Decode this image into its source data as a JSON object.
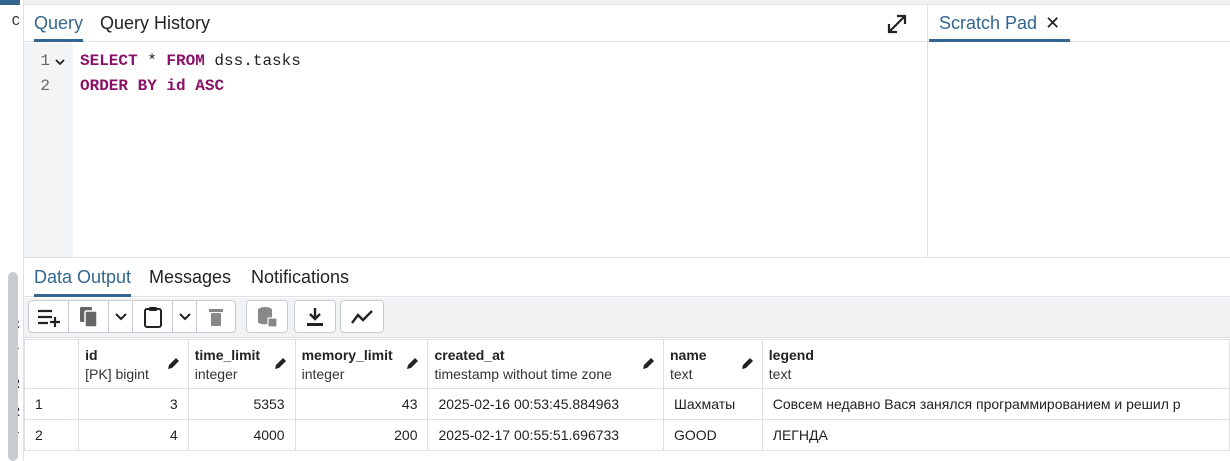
{
  "left_strip": {
    "chars": [
      "C",
      "C",
      "r",
      "R",
      "R",
      "r"
    ]
  },
  "query_tool": {
    "tabs": [
      "Query",
      "Query History"
    ],
    "line_numbers": [
      "1",
      "2"
    ],
    "code": {
      "line1": {
        "kw1": "SELECT",
        "star": " * ",
        "kw2": "FROM",
        "rest": " dss.tasks"
      },
      "line2": {
        "kw1": "ORDER",
        "sp": " ",
        "kw2": "BY",
        "mid": " id ",
        "kw3": "ASC"
      }
    }
  },
  "scratch_pad": {
    "tab_label": "Scratch Pad"
  },
  "output": {
    "tabs": [
      "Data Output",
      "Messages",
      "Notifications"
    ],
    "toolbar_icons": [
      "add-row-icon",
      "copy-icon",
      "chevron-down-icon",
      "paste-icon",
      "chevron-down-icon",
      "delete-icon",
      "save-data-icon",
      "download-icon",
      "graph-icon"
    ],
    "columns": [
      {
        "name": "id",
        "type": "[PK] bigint"
      },
      {
        "name": "time_limit",
        "type": "integer"
      },
      {
        "name": "memory_limit",
        "type": "integer"
      },
      {
        "name": "created_at",
        "type": "timestamp without time zone"
      },
      {
        "name": "name",
        "type": "text"
      },
      {
        "name": "legend",
        "type": "text"
      }
    ],
    "rows": [
      {
        "n": "1",
        "id": "3",
        "time_limit": "5353",
        "memory_limit": "43",
        "created_at": "2025-02-16 00:53:45.884963",
        "name": "Шахматы",
        "legend": "Совсем недавно Вася занялся программированием и решил р"
      },
      {
        "n": "2",
        "id": "4",
        "time_limit": "4000",
        "memory_limit": "200",
        "created_at": "2025-02-17 00:55:51.696733",
        "name": "GOOD",
        "legend": "ЛЕГНДА"
      }
    ]
  },
  "colors": {
    "accent": "#326690",
    "keyword": "#8a1167"
  }
}
